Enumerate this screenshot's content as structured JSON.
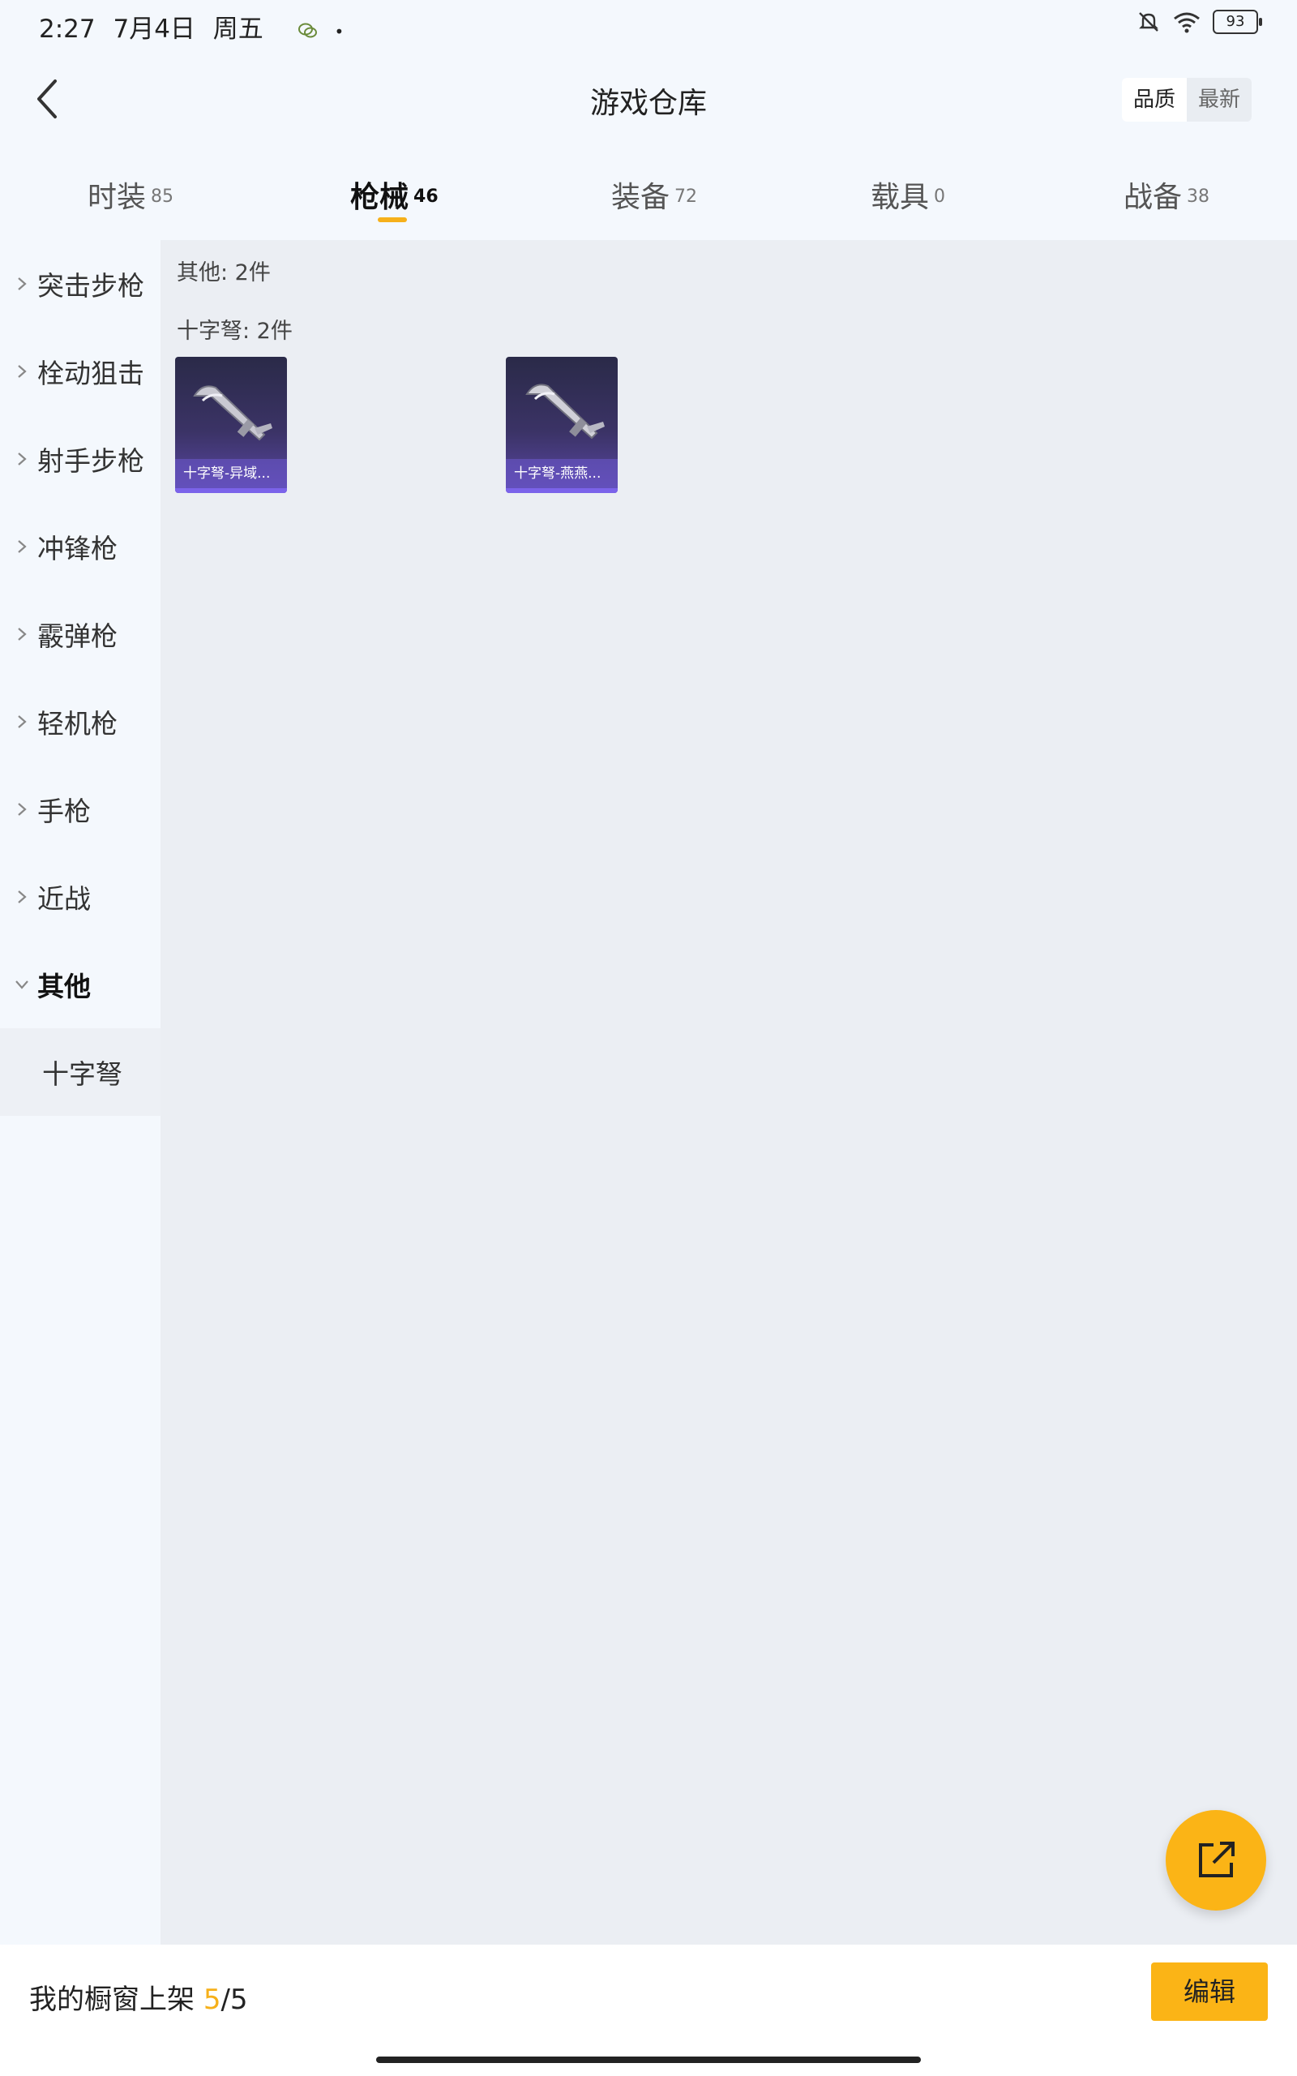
{
  "status": {
    "time": "2:27",
    "date": "7月4日",
    "weekday": "周五",
    "battery": "93",
    "icons": [
      "wechat-icon",
      "bell-muted-icon",
      "wifi-icon",
      "battery-icon"
    ]
  },
  "header": {
    "title": "游戏仓库",
    "sort_quality": "品质",
    "sort_newest": "最新"
  },
  "tabs": [
    {
      "label": "时装",
      "count": "85",
      "active": false
    },
    {
      "label": "枪械",
      "count": "46",
      "active": true
    },
    {
      "label": "装备",
      "count": "72",
      "active": false
    },
    {
      "label": "载具",
      "count": "0",
      "active": false
    },
    {
      "label": "战备",
      "count": "38",
      "active": false
    }
  ],
  "sidebar": {
    "items": [
      {
        "label": "突击步枪"
      },
      {
        "label": "栓动狙击"
      },
      {
        "label": "射手步枪"
      },
      {
        "label": "冲锋枪"
      },
      {
        "label": "霰弹枪"
      },
      {
        "label": "轻机枪"
      },
      {
        "label": "手枪"
      },
      {
        "label": "近战"
      },
      {
        "label": "其他"
      }
    ],
    "sub_item": "十字弩"
  },
  "content": {
    "group_other": "其他: 2件",
    "group_crossbow": "十字弩: 2件",
    "cards": [
      {
        "caption": "十字弩-异域..."
      },
      {
        "caption": "十字弩-燕燕..."
      }
    ]
  },
  "bottom": {
    "label": "我的橱窗上架",
    "current": "5",
    "slash_total": "/5",
    "edit_label": "编辑"
  },
  "colors": {
    "accent": "#fbb416",
    "card_bg": "#3b3366",
    "content_bg": "#ebeef3"
  }
}
